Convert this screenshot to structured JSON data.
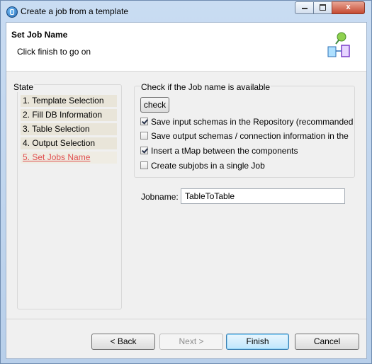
{
  "window": {
    "title": "Create a job from a template",
    "controls": {
      "minimize": "",
      "maximize": "",
      "close": "x"
    }
  },
  "header": {
    "title": "Set Job Name",
    "subtitle": "Click finish to go on",
    "icon": "wizard-icon"
  },
  "state": {
    "label": "State",
    "steps": [
      "1. Template Selection",
      "2. Fill DB Information",
      "3. Table Selection",
      "4. Output Selection",
      "5. Set Jobs Name"
    ],
    "current_index": 4
  },
  "availability": {
    "label": "Check if the Job name is available",
    "check_button": "check",
    "options": [
      {
        "label": "Save input schemas in the Repository (recommanded",
        "checked": true
      },
      {
        "label": "Save output schemas / connection information in the",
        "checked": false
      },
      {
        "label": "Insert a tMap between the components",
        "checked": true
      },
      {
        "label": "Create subjobs in a single Job",
        "checked": false
      }
    ]
  },
  "jobname": {
    "label": "Jobname:",
    "value": "TableToTable"
  },
  "footer": {
    "back": "< Back",
    "next": "Next >",
    "finish": "Finish",
    "cancel": "Cancel"
  },
  "colors": {
    "current_step": "#e05050",
    "step_bg": "#e9e5d9",
    "dialog_bg": "#f0f0f0"
  }
}
